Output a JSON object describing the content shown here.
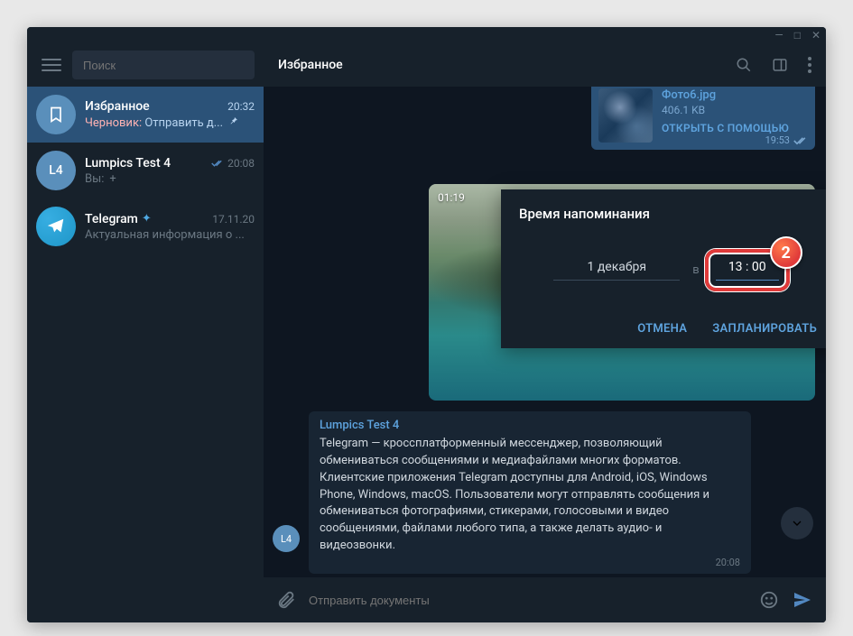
{
  "window": {
    "minimize": "—",
    "maximize": "□",
    "close": "✕"
  },
  "search": {
    "placeholder": "Поиск"
  },
  "chats": [
    {
      "name": "Избранное",
      "time": "20:32",
      "draft_label": "Черновик:",
      "preview": "Отправить д...",
      "pinned": true,
      "active": true,
      "avatar": "saved"
    },
    {
      "name": "Lumpics Test 4",
      "time": "20:08",
      "preview_prefix": "Вы:",
      "preview": "+",
      "avatar": "L4",
      "read": true
    },
    {
      "name": "Telegram",
      "time": "17.11.20",
      "preview": "Актуальная информация о ...",
      "avatar": "tg",
      "verified": true
    }
  ],
  "header": {
    "title": "Избранное"
  },
  "file_msg": {
    "name": "Фото6.jpg",
    "size": "406.1 KB",
    "open": "ОТКРЫТЬ С ПОМОЩЬЮ",
    "time": "19:53"
  },
  "video": {
    "duration": "01:19"
  },
  "fwd": {
    "from": "Lumpics Test 4",
    "text": "Telegram — кроссплатформенный мессенджер, позволяющий обмениваться сообщениями и медиафайлами многих форматов. Клиентские приложения Telegram доступны для Android, iOS, Windows Phone, Windows, macOS. Пользователи могут отправлять сообщения и обмениваться фотографиями, стикерами, голосовыми и видео сообщениями, файлами любого типа, а также делать аудио- и видеозвонки.",
    "time": "20:08",
    "avatar": "L4"
  },
  "compose": {
    "placeholder": "Отправить документы"
  },
  "dialog": {
    "title": "Время напоминания",
    "date": "1 декабря",
    "at": "в",
    "time": "13 : 00",
    "cancel": "ОТМЕНА",
    "confirm": "ЗАПЛАНИРОВАТЬ",
    "step": "2"
  }
}
